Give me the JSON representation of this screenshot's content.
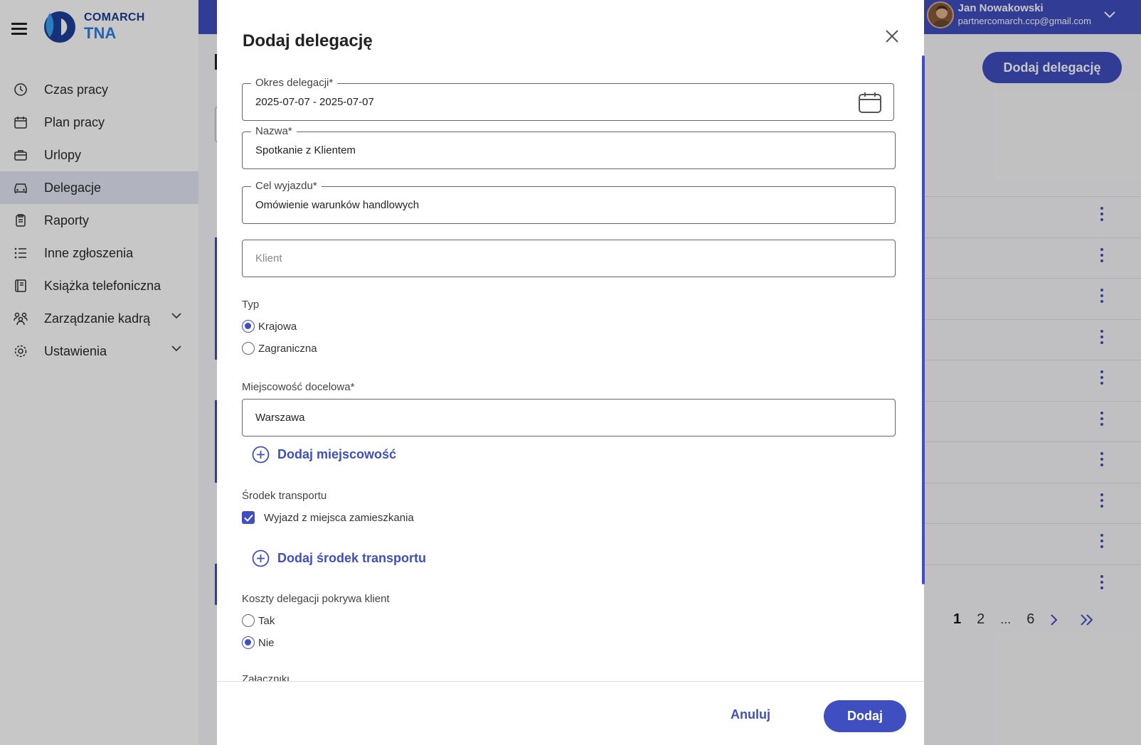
{
  "app": {
    "brand_line1": "COMARCH",
    "brand_line2": "TNA",
    "accent": "#3f4fbf"
  },
  "sidebar": {
    "items": [
      {
        "label": "Czas pracy",
        "icon": "clock-icon"
      },
      {
        "label": "Plan pracy",
        "icon": "calendar-icon"
      },
      {
        "label": "Urlopy",
        "icon": "suitcase-icon"
      },
      {
        "label": "Delegacje",
        "icon": "car-icon",
        "active": true
      },
      {
        "label": "Raporty",
        "icon": "clipboard-icon"
      },
      {
        "label": "Inne zgłoszenia",
        "icon": "list-icon"
      },
      {
        "label": "Książka telefoniczna",
        "icon": "book-icon"
      },
      {
        "label": "Zarządzanie kadrą",
        "icon": "people-icon",
        "expandable": true
      },
      {
        "label": "Ustawienia",
        "icon": "gear-icon",
        "expandable": true
      }
    ]
  },
  "header": {
    "user_name": "Jan Nowakowski",
    "user_email": "partnercomarch.ccp@gmail.com"
  },
  "page": {
    "add_button": "Dodaj delegację",
    "pagination": {
      "current": "1",
      "next_page": "2",
      "ellipsis": "...",
      "last": "6"
    }
  },
  "modal": {
    "title": "Dodaj delegację",
    "period": {
      "label": "Okres delegacji*",
      "value": "2025-07-07 - 2025-07-07"
    },
    "name": {
      "label": "Nazwa*",
      "value": "Spotkanie z Klientem"
    },
    "purpose": {
      "label": "Cel wyjazdu*",
      "value": "Omówienie warunków handlowych"
    },
    "client": {
      "placeholder": "Klient"
    },
    "type": {
      "label": "Typ",
      "options": [
        "Krajowa",
        "Zagraniczna"
      ],
      "selected": "Krajowa"
    },
    "destination": {
      "label": "Miejscowość docelowa*",
      "value": "Warszawa"
    },
    "add_place": "Dodaj miejscowość",
    "transport": {
      "label": "Środek transportu",
      "checkbox": "Wyjazd z miejsca zamieszkania",
      "checked": true
    },
    "add_transport": "Dodaj środek transportu",
    "costs": {
      "label": "Koszty delegacji pokrywa klient",
      "options": [
        "Tak",
        "Nie"
      ],
      "selected": "Nie"
    },
    "attachments_label": "Załączniki",
    "cancel": "Anuluj",
    "submit": "Dodaj"
  }
}
